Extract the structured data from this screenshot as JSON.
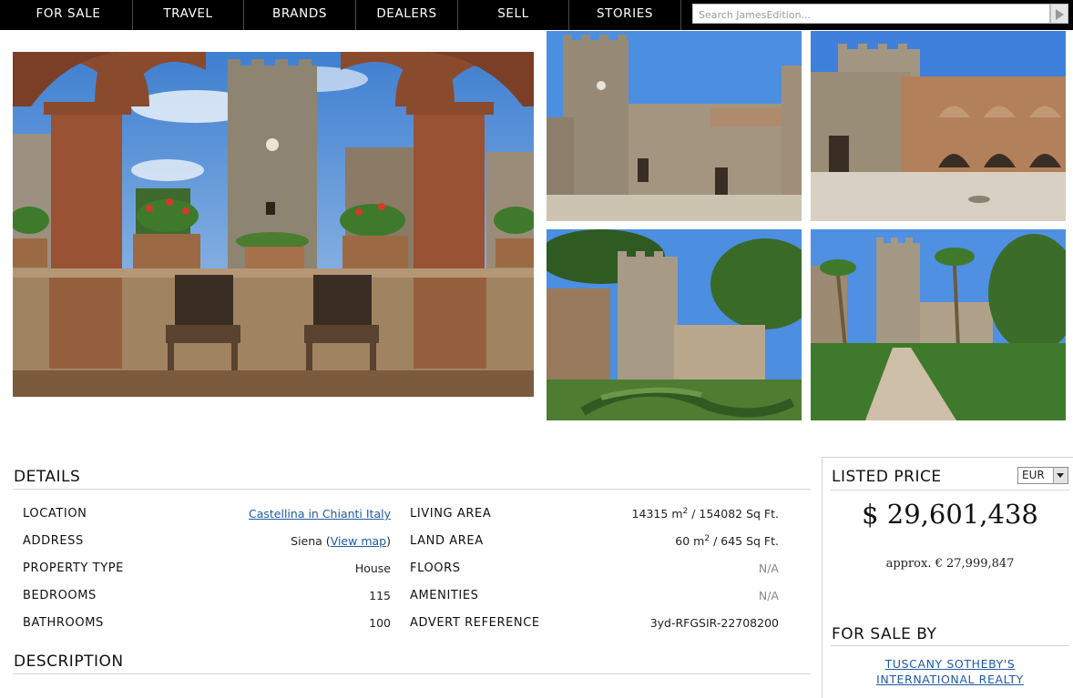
{
  "nav": {
    "items": [
      "FOR SALE",
      "TRAVEL",
      "BRANDS",
      "DEALERS",
      "SELL",
      "STORIES"
    ],
    "search_placeholder": "Search JamesEdition..."
  },
  "gallery": {
    "photos": [
      "main-loggia-tower",
      "castle-tower-courtyard",
      "arcaded-courtyard",
      "tower-garden",
      "palm-garden-path"
    ]
  },
  "details": {
    "title": "DETAILS",
    "left": [
      {
        "label": "LOCATION",
        "value": "Castellina in Chianti Italy"
      },
      {
        "label": "ADDRESS",
        "value": "Siena",
        "link": "View map"
      },
      {
        "label": "PROPERTY TYPE",
        "value": "House"
      },
      {
        "label": "BEDROOMS",
        "value": "115"
      },
      {
        "label": "BATHROOMS",
        "value": "100"
      }
    ],
    "right": [
      {
        "label": "LIVING AREA",
        "value_num": "14315 m",
        "value_sup": "2",
        "value_rest": " / 154082 Sq Ft."
      },
      {
        "label": "LAND AREA",
        "value_num": "60 m",
        "value_sup": "2",
        "value_rest": " / 645 Sq Ft."
      },
      {
        "label": "FLOORS",
        "value": "N/A"
      },
      {
        "label": "AMENITIES",
        "value": "N/A"
      },
      {
        "label": "ADVERT REFERENCE",
        "value": "3yd-RFGSIR-22708200"
      }
    ]
  },
  "description": {
    "title": "DESCRIPTION"
  },
  "price": {
    "title": "LISTED PRICE",
    "currency": "EUR",
    "amount": "$ 29,601,438",
    "approx": "approx. € 27,999,847"
  },
  "seller": {
    "title": "FOR SALE BY",
    "name_line1": "TUSCANY SOTHEBY'S",
    "name_line2": "INTERNATIONAL REALTY"
  }
}
